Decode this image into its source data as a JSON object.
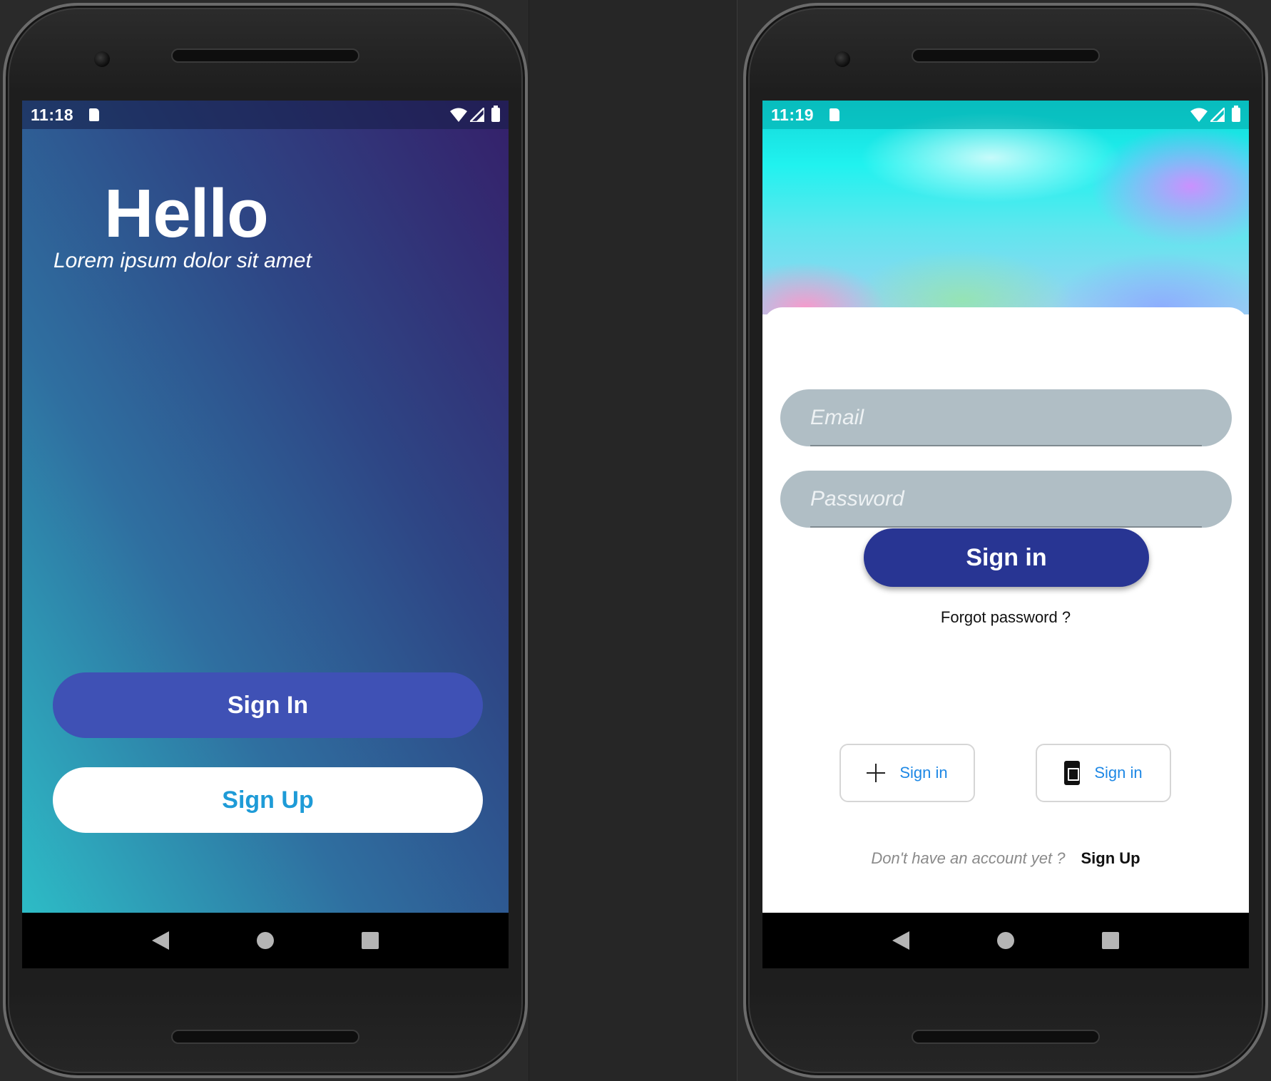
{
  "left_screen": {
    "status": {
      "time": "11:18"
    },
    "title": "Hello",
    "subtitle": "Lorem ipsum dolor sit amet",
    "sign_in_label": "Sign In",
    "sign_up_label": "Sign Up",
    "colors": {
      "gradient": [
        "#2dbcc6",
        "#2f6fa0",
        "#2e4685",
        "#35206a"
      ],
      "sign_in_bg": "#3f51b5",
      "sign_up_text": "#1e9bd7"
    }
  },
  "right_screen": {
    "status": {
      "time": "11:19"
    },
    "email_placeholder": "Email",
    "password_placeholder": "Password",
    "sign_in_label": "Sign in",
    "forgot_label": "Forgot password ?",
    "social": [
      {
        "icon": "plus-icon",
        "label": "Sign in"
      },
      {
        "icon": "phone-icon",
        "label": "Sign in"
      }
    ],
    "footer": {
      "question": "Don't have an account yet ?",
      "link": "Sign Up"
    },
    "colors": {
      "primary": "#283593",
      "field_bg": "#b0bec5",
      "link": "#1e88e5"
    }
  },
  "navbar": {
    "icons": [
      "back-icon",
      "home-icon",
      "recent-apps-icon"
    ]
  }
}
